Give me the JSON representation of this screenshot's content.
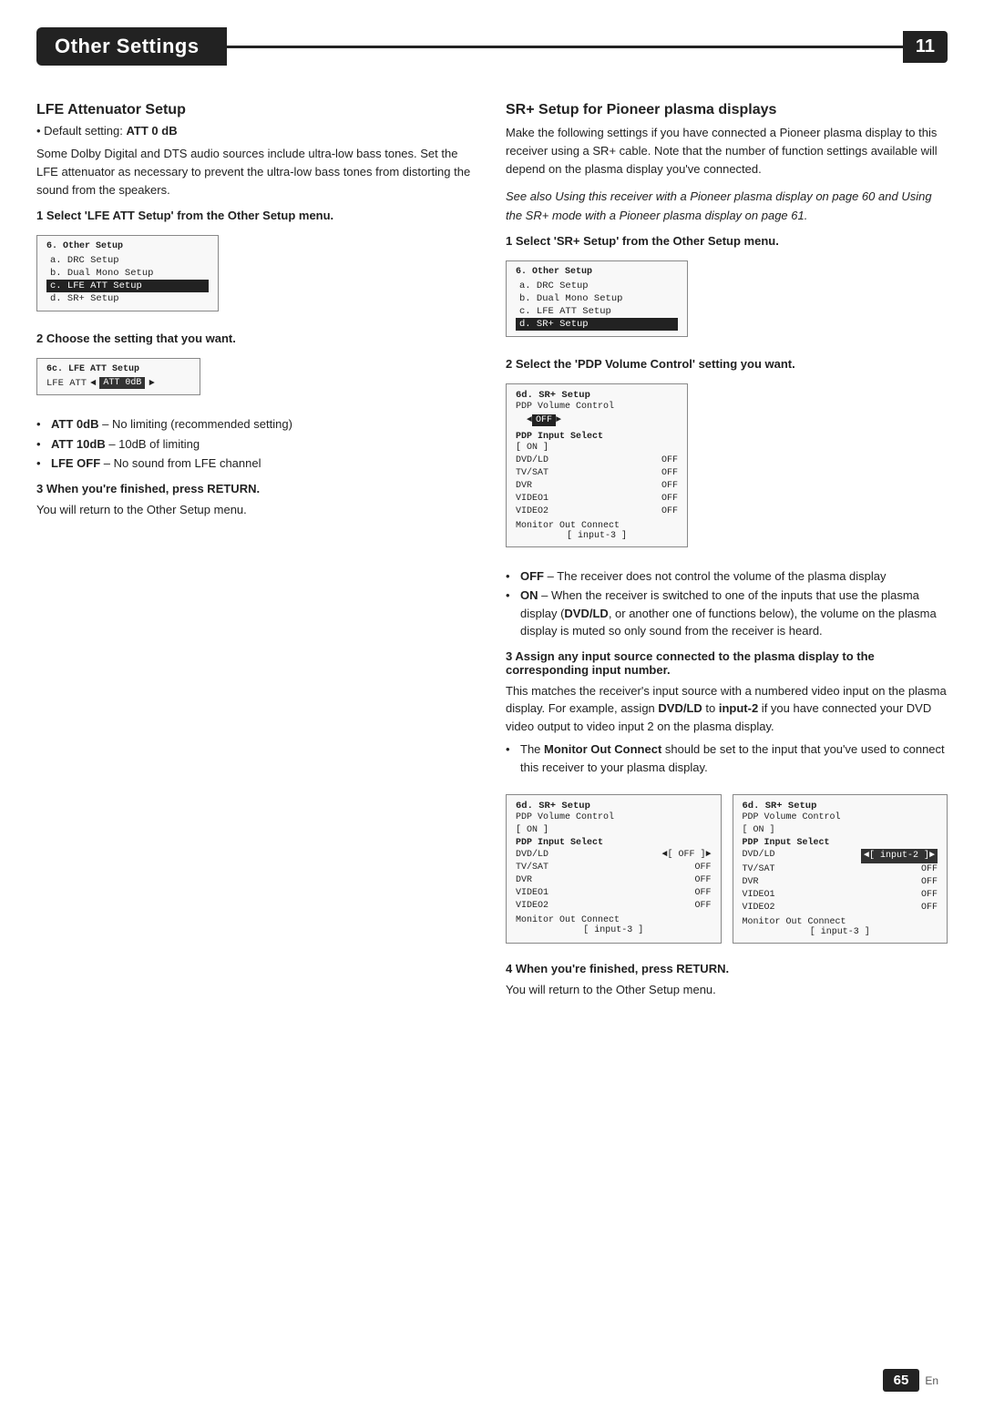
{
  "header": {
    "title": "Other Settings",
    "chapter_num": "11",
    "page_num": "65",
    "page_lang": "En"
  },
  "left_section": {
    "title": "LFE Attenuator Setup",
    "default_label": "Default setting:",
    "default_value": "ATT 0 dB",
    "body1": "Some Dolby Digital and DTS audio sources include ultra-low bass tones. Set the LFE attenuator as necessary to prevent the ultra-low bass tones from distorting the sound from the speakers.",
    "step1_header": "1   Select 'LFE ATT Setup' from the Other Setup menu.",
    "step1_screen": {
      "title": "6. Other Setup",
      "items": [
        "a. DRC Setup",
        "b. Dual Mono Setup",
        "c. LFE ATT Setup",
        "d. SR+ Setup"
      ],
      "highlighted_index": 2
    },
    "step2_header": "2   Choose the setting that you want.",
    "step2_screen": {
      "title": "6c. LFE ATT Setup",
      "lfe_label": "LFE ATT",
      "lfe_value": "ATT 0dB"
    },
    "bullets": [
      {
        "bold_part": "ATT 0dB",
        "rest": " – No limiting (recommended setting)"
      },
      {
        "bold_part": "ATT 10dB",
        "rest": " – 10dB of limiting"
      },
      {
        "bold_part": "LFE OFF",
        "rest": " – No sound from LFE channel"
      }
    ],
    "step3_header": "3   When you're finished, press RETURN.",
    "step3_body": "You will return to the Other Setup menu."
  },
  "right_section": {
    "title": "SR+ Setup for Pioneer plasma displays",
    "body1": "Make the following settings if you have connected a Pioneer plasma display to this receiver using a SR+ cable. Note that the number of function settings available will depend on the plasma display you've connected.",
    "see_also": "See also Using this receiver with a Pioneer plasma display on page 60 and Using the SR+ mode with a Pioneer plasma display on page 61.",
    "step1_header": "1   Select 'SR+ Setup' from the Other Setup menu.",
    "step1_screen": {
      "title": "6. Other Setup",
      "items": [
        "a. DRC Setup",
        "b. Dual Mono Setup",
        "c. LFE ATT Setup",
        "d. SR+ Setup"
      ],
      "highlighted_index": 3
    },
    "step2_header": "2   Select the 'PDP Volume Control' setting you want.",
    "step2_screen": {
      "title": "6d. SR+ Setup",
      "pdp_volume_label": "PDP Volume Control",
      "pdp_volume_value": "OFF",
      "pdp_input_section": "PDP Input Select",
      "pdp_input_sub": "[ ON ]",
      "inputs": [
        {
          "name": "DVD/LD",
          "val": "OFF"
        },
        {
          "name": "TV/SAT",
          "val": "OFF"
        },
        {
          "name": "DVR",
          "val": "OFF"
        },
        {
          "name": "VIDEO1",
          "val": "OFF"
        },
        {
          "name": "VIDEO2",
          "val": "OFF"
        }
      ],
      "monitor_connect": "Monitor Out Connect",
      "monitor_val": "[ input-3 ]"
    },
    "bullet_off": {
      "bold_part": "OFF",
      "rest": " – The receiver does not control the volume of the plasma display"
    },
    "bullet_on": {
      "bold_part": "ON",
      "rest": " – When the receiver is switched to one of the inputs that use the plasma display (DVD/LD, or another one of functions below), the volume on the plasma display is muted so only sound from the receiver is heard."
    },
    "step3_header": "3   Assign any input source connected to the plasma display to the corresponding input number.",
    "step3_body1": "This matches the receiver's input source with a numbered video input on the plasma display. For example, assign DVD/LD to input-2 if you have connected your DVD video output to video input 2 on the plasma display.",
    "step3_bullet": "The Monitor Out Connect should be set to the input that you've used to connect this receiver to your plasma display.",
    "dual_screen_left": {
      "title": "6d. SR+ Setup",
      "pdp_volume_label": "PDP Volume Control",
      "pdp_volume_bracket": "[ ON ]",
      "pdp_input_section": "PDP Input Select",
      "dvdld_value": "◄[ OFF ]►",
      "inputs": [
        {
          "name": "DVD/LD",
          "val": "◄[ OFF ]►"
        },
        {
          "name": "TV/SAT",
          "val": "OFF"
        },
        {
          "name": "DVR",
          "val": "OFF"
        },
        {
          "name": "VIDEO1",
          "val": "OFF"
        },
        {
          "name": "VIDEO2",
          "val": "OFF"
        }
      ],
      "monitor_connect": "Monitor Out Connect",
      "monitor_val": "[ input-3 ]"
    },
    "dual_screen_right": {
      "title": "6d. SR+ Setup",
      "pdp_volume_label": "PDP Volume Control",
      "pdp_volume_bracket": "[ ON ]",
      "pdp_input_section": "PDP Input Select",
      "inputs": [
        {
          "name": "DVD/LD",
          "val": "◄[ input-2 ]►"
        },
        {
          "name": "TV/SAT",
          "val": "OFF"
        },
        {
          "name": "DVR",
          "val": "OFF"
        },
        {
          "name": "VIDEO1",
          "val": "OFF"
        },
        {
          "name": "VIDEO2",
          "val": "OFF"
        }
      ],
      "monitor_connect": "Monitor Out Connect",
      "monitor_val": "[ input-3 ]"
    },
    "step4_header": "4   When you're finished, press RETURN.",
    "step4_body": "You will return to the Other Setup menu."
  }
}
